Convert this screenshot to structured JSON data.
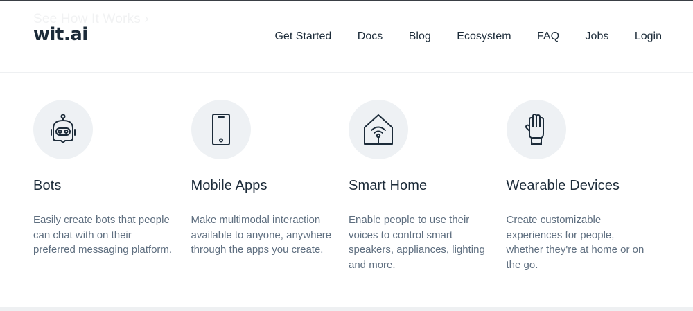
{
  "ghost_link": "See How It Works ›",
  "header": {
    "logo": "wit.ai",
    "nav": [
      "Get Started",
      "Docs",
      "Blog",
      "Ecosystem",
      "FAQ",
      "Jobs",
      "Login"
    ]
  },
  "features": [
    {
      "icon": "robot-icon",
      "title": "Bots",
      "description": "Easily create bots that people can chat with on their preferred messaging platform."
    },
    {
      "icon": "smartphone-icon",
      "title": "Mobile Apps",
      "description": "Make multimodal interaction available to anyone, anywhere through the apps you create."
    },
    {
      "icon": "smart-home-icon",
      "title": "Smart Home",
      "description": "Enable people to use their voices to control smart speakers, appliances, lighting and more."
    },
    {
      "icon": "wearable-glove-icon",
      "title": "Wearable Devices",
      "description": "Create customizable experiences for people, whether they're at home or on the go."
    }
  ],
  "colors": {
    "text": "#1c2b39",
    "muted_text": "#5f6f80",
    "icon_circle": "#eef1f4"
  }
}
